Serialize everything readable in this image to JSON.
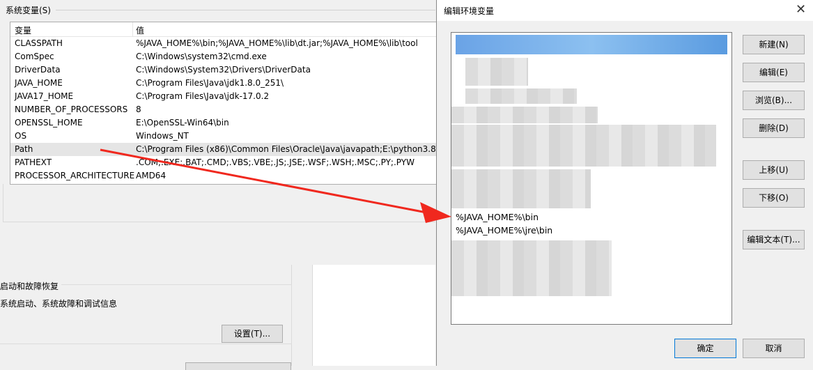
{
  "system_variables": {
    "title": "系统变量(S)",
    "columns": {
      "name": "变量",
      "value": "值"
    },
    "rows": [
      {
        "name": "CLASSPATH",
        "value": "%JAVA_HOME%\\bin;%JAVA_HOME%\\lib\\dt.jar;%JAVA_HOME%\\lib\\tool"
      },
      {
        "name": "ComSpec",
        "value": "C:\\Windows\\system32\\cmd.exe"
      },
      {
        "name": "DriverData",
        "value": "C:\\Windows\\System32\\Drivers\\DriverData"
      },
      {
        "name": "JAVA_HOME",
        "value": "C:\\Program Files\\Java\\jdk1.8.0_251\\"
      },
      {
        "name": "JAVA17_HOME",
        "value": "C:\\Program Files\\Java\\jdk-17.0.2"
      },
      {
        "name": "NUMBER_OF_PROCESSORS",
        "value": "8"
      },
      {
        "name": "OPENSSL_HOME",
        "value": "E:\\OpenSSL-Win64\\bin"
      },
      {
        "name": "OS",
        "value": "Windows_NT"
      },
      {
        "name": "Path",
        "value": "C:\\Program Files (x86)\\Common Files\\Oracle\\Java\\javapath;E:\\python3.8\\"
      },
      {
        "name": "PATHEXT",
        "value": ".COM;.EXE;.BAT;.CMD;.VBS;.VBE;.JS;.JSE;.WSF;.WSH;.MSC;.PY;.PYW"
      },
      {
        "name": "PROCESSOR_ARCHITECTURE",
        "value": "AMD64"
      }
    ]
  },
  "system_properties": {
    "startup_title": "启动和故障恢复",
    "startup_desc": "系统启动、系统故障和调试信息",
    "settings_button": "设置(T)..."
  },
  "edit_dialog": {
    "title": "编辑环境变量",
    "close_glyph": "✕",
    "path_entries": [
      "%JAVA_HOME%\\bin",
      "%JAVA_HOME%\\jre\\bin"
    ],
    "buttons": {
      "new": "新建(N)",
      "edit": "编辑(E)",
      "browse": "浏览(B)...",
      "delete": "删除(D)",
      "move_up": "上移(U)",
      "move_down": "下移(O)",
      "edit_text": "编辑文本(T)...",
      "ok": "确定",
      "cancel": "取消"
    }
  },
  "colors": {
    "arrow": "#f0281e",
    "selection": "#6aa3e6"
  }
}
